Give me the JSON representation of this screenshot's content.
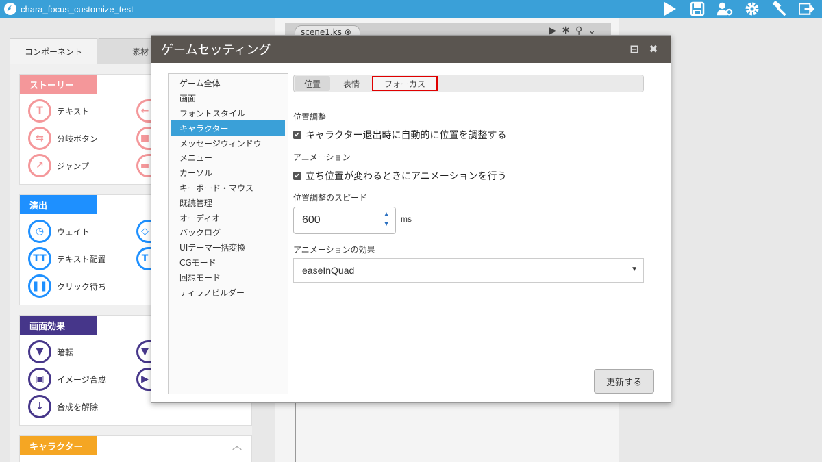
{
  "app": {
    "title": "chara_focus_customize_test"
  },
  "left_panel": {
    "tabs": [
      "コンポーネント",
      "素材"
    ],
    "sections": [
      {
        "title": "ストーリー",
        "color": "#f4979a",
        "items": [
          "テキスト",
          "分岐ボタン",
          "ジャンプ"
        ]
      },
      {
        "title": "演出",
        "color": "#1e90ff",
        "items": [
          "ウェイト",
          "テキスト配置",
          "クリック待ち"
        ]
      },
      {
        "title": "画面効果",
        "color": "#46368a",
        "items": [
          "暗転",
          "イメージ合成",
          "合成を解除"
        ]
      },
      {
        "title": "キャラクター",
        "color": "#f5a623",
        "items": []
      }
    ]
  },
  "editor": {
    "tab_label": "scene1.ks"
  },
  "modal": {
    "title": "ゲームセッティング",
    "menu": [
      "ゲーム全体",
      "画面",
      "フォントスタイル",
      "キャラクター",
      "メッセージウィンドウ",
      "メニュー",
      "カーソル",
      "キーボード・マウス",
      "既読管理",
      "オーディオ",
      "バックログ",
      "UIテーマ一括変換",
      "CGモード",
      "回想モード",
      "ティラノビルダー"
    ],
    "selected_menu": "キャラクター",
    "subtabs": [
      "位置",
      "表情",
      "フォーカス"
    ],
    "position_adjust_label": "位置調整",
    "auto_adjust_checkbox": "キャラクター退出時に自動的に位置を調整する",
    "animation_label": "アニメーション",
    "animation_checkbox": "立ち位置が変わるときにアニメーションを行う",
    "speed_label": "位置調整のスピード",
    "speed_value": "600",
    "speed_unit": "ms",
    "effect_label": "アニメーションの効果",
    "effect_value": "easeInQuad",
    "update_button": "更新する"
  }
}
